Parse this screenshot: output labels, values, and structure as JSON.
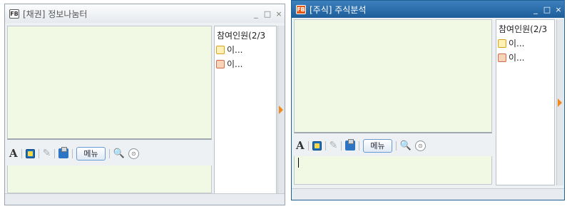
{
  "windows": [
    {
      "title": "[채권] 정보나눔터",
      "fb_label": "FB",
      "state": "inactive",
      "controls": {
        "minimize": "_",
        "maximize": "□",
        "close": "×"
      },
      "toolbar": {
        "font_label": "A",
        "menu_label": "메뉴",
        "search_glyph": "🔍",
        "more_glyph": "⊙"
      },
      "members_header": "참여인원(2/3",
      "members": [
        {
          "icon": "crown-face-icon",
          "name": "이..."
        },
        {
          "icon": "girl-face-icon",
          "name": "이..."
        }
      ]
    },
    {
      "title": "[주식] 주식분석",
      "fb_label": "FB",
      "state": "active",
      "controls": {
        "minimize": "_",
        "maximize": "□",
        "close": "×"
      },
      "toolbar": {
        "font_label": "A",
        "menu_label": "메뉴",
        "search_glyph": "🔍",
        "more_glyph": "⊙"
      },
      "members_header": "참여인원(2/3",
      "members": [
        {
          "icon": "crown-face-icon",
          "name": "이..."
        },
        {
          "icon": "girl-face-icon",
          "name": "이..."
        }
      ]
    }
  ],
  "colors": {
    "active_titlebar": "#1d5e9a",
    "chat_background": "#f1f8e4",
    "splitter_arrow": "#f08a1c"
  }
}
